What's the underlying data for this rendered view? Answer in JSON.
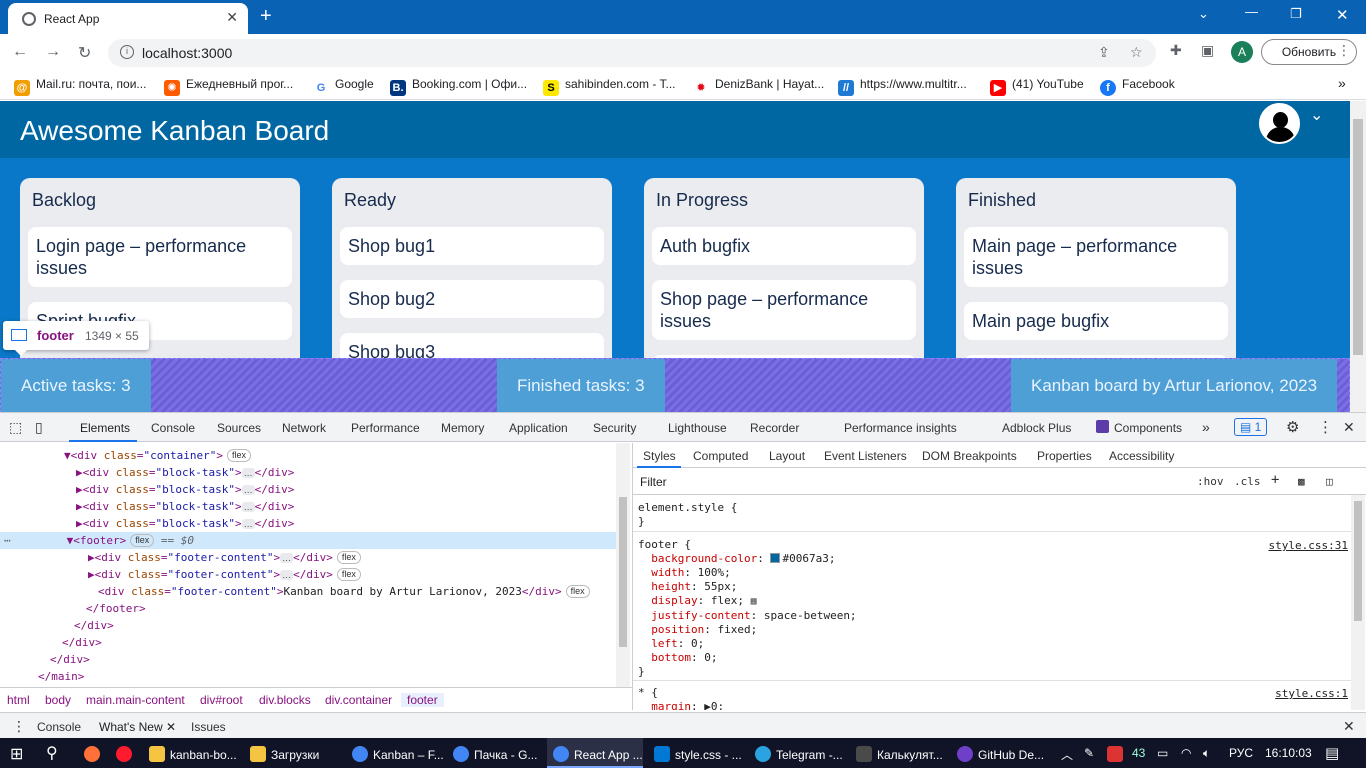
{
  "browser": {
    "tab_title": "React App",
    "tab_close": "✕",
    "new_tab": "+",
    "url": "localhost:3000",
    "update_button": "Обновить",
    "profile_letter": "A",
    "bookmarks": [
      {
        "label": "Mail.ru: почта, пои...",
        "icon": "mailru-icon",
        "color": "#f29d00"
      },
      {
        "label": "Ежедневный прог...",
        "icon": "sun-icon",
        "color": "#ff5a00"
      },
      {
        "label": "Google",
        "icon": "google-icon",
        "color": "#4285f4"
      },
      {
        "label": "Booking.com | Офи...",
        "icon": "booking-icon",
        "color": "#003580"
      },
      {
        "label": "sahibinden.com - T...",
        "icon": "sahibinden-icon",
        "color": "#ffe800"
      },
      {
        "label": "DenizBank | Hayat...",
        "icon": "denizbank-icon",
        "color": "#e30613"
      },
      {
        "label": "https://www.multitr...",
        "icon": "multitran-icon",
        "color": "#1f7ad4"
      },
      {
        "label": "(41) YouTube",
        "icon": "youtube-icon",
        "color": "#ff0000"
      },
      {
        "label": "Facebook",
        "icon": "facebook-icon",
        "color": "#1877f2"
      }
    ],
    "bookmarks_more": "»"
  },
  "app": {
    "title": "Awesome Kanban Board",
    "columns": [
      {
        "title": "Backlog",
        "cards": [
          "Login page – performance issues",
          "Sprint bugfix"
        ]
      },
      {
        "title": "Ready",
        "cards": [
          "Shop bug1",
          "Shop bug2",
          "Shop bug3"
        ]
      },
      {
        "title": "In Progress",
        "cards": [
          "Auth bugfix",
          "Shop page – performance issues"
        ]
      },
      {
        "title": "Finished",
        "cards": [
          "Main page – performance issues",
          "Main page bugfix"
        ]
      }
    ],
    "footer": {
      "active": "Active tasks: 3",
      "finished": "Finished tasks: 3",
      "credit": "Kanban board by Artur Larionov, 2023"
    }
  },
  "inspect_tooltip": {
    "tag": "footer",
    "dims": "1349 × 55"
  },
  "devtools": {
    "tabs": [
      "Elements",
      "Console",
      "Sources",
      "Network",
      "Performance",
      "Memory",
      "Application",
      "Security",
      "Lighthouse",
      "Recorder",
      "Performance insights",
      "Adblock Plus",
      "Components"
    ],
    "issues_count": "1",
    "dom_lines": [
      {
        "open": "<div ",
        "attr": "class",
        "val": "\"container\"",
        "close": ">",
        "pill": "flex"
      },
      {
        "open": "<div ",
        "attr": "class",
        "val": "\"block-task\"",
        "close": ">",
        "rest": "</div>"
      },
      {
        "open": "<div ",
        "attr": "class",
        "val": "\"block-task\"",
        "close": ">",
        "rest": "</div>"
      },
      {
        "open": "<div ",
        "attr": "class",
        "val": "\"block-task\"",
        "close": ">",
        "rest": "</div>"
      },
      {
        "open": "<div ",
        "attr": "class",
        "val": "\"block-task\"",
        "close": ">",
        "rest": "</div>"
      },
      {
        "open": "<footer>",
        "pill": "flex",
        "marker": "== $0"
      },
      {
        "open": "<div ",
        "attr": "class",
        "val": "\"footer-content\"",
        "close": ">",
        "rest": "</div>",
        "pill": "flex"
      },
      {
        "open": "<div ",
        "attr": "class",
        "val": "\"footer-content\"",
        "close": ">",
        "rest": "</div>",
        "pill": "flex"
      },
      {
        "open": "<div ",
        "attr": "class",
        "val": "\"footer-content\"",
        "close": ">",
        "text": "Kanban board by Artur Larionov, 2023",
        "rest": "</div>",
        "pill": "flex"
      },
      {
        "open": "</footer>"
      },
      {
        "open": "</div>"
      },
      {
        "open": "</div>"
      },
      {
        "open": "</div>"
      },
      {
        "open": "</main>"
      }
    ],
    "breadcrumbs": [
      "html",
      "body",
      "main.main-content",
      "div#root",
      "div.blocks",
      "div.container",
      "footer"
    ],
    "style_tabs": [
      "Styles",
      "Computed",
      "Layout",
      "Event Listeners",
      "DOM Breakpoints",
      "Properties",
      "Accessibility"
    ],
    "filter_placeholder": "Filter",
    "hov": ":hov",
    "cls": ".cls",
    "element_style": "element.style {",
    "footer_rule": {
      "selector": "footer {",
      "source": "style.css:31",
      "props": [
        {
          "name": "background-color",
          "value": "#0067a3;",
          "swatch": "#0067a3"
        },
        {
          "name": "width",
          "value": "100%;"
        },
        {
          "name": "height",
          "value": "55px;"
        },
        {
          "name": "display",
          "value": "flex;"
        },
        {
          "name": "justify-content",
          "value": "space-between;"
        },
        {
          "name": "position",
          "value": "fixed;"
        },
        {
          "name": "left",
          "value": "0;"
        },
        {
          "name": "bottom",
          "value": "0;"
        }
      ]
    },
    "star_rule": {
      "selector": "* {",
      "source": "style.css:1",
      "prop": "margin",
      "value": "0;"
    },
    "drawer_tabs": [
      "Console",
      "What's New",
      "Issues"
    ]
  },
  "taskbar": {
    "items": [
      {
        "label": "kanban-bo...",
        "color": "#f5c542"
      },
      {
        "label": "Загрузки",
        "color": "#f5c542"
      },
      {
        "label": "Kanban – F...",
        "color": "#4285f4"
      },
      {
        "label": "Пачка - G...",
        "color": "#4285f4"
      },
      {
        "label": "React App ...",
        "color": "#4285f4"
      },
      {
        "label": "style.css - ...",
        "color": "#0078d4"
      },
      {
        "label": "Telegram -...",
        "color": "#2aa3e0"
      },
      {
        "label": "Калькулят...",
        "color": "#4a4a4a"
      },
      {
        "label": "GitHub De...",
        "color": "#6e40c9"
      }
    ],
    "temp": "43",
    "lang": "РУС",
    "time": "16:10:03"
  }
}
